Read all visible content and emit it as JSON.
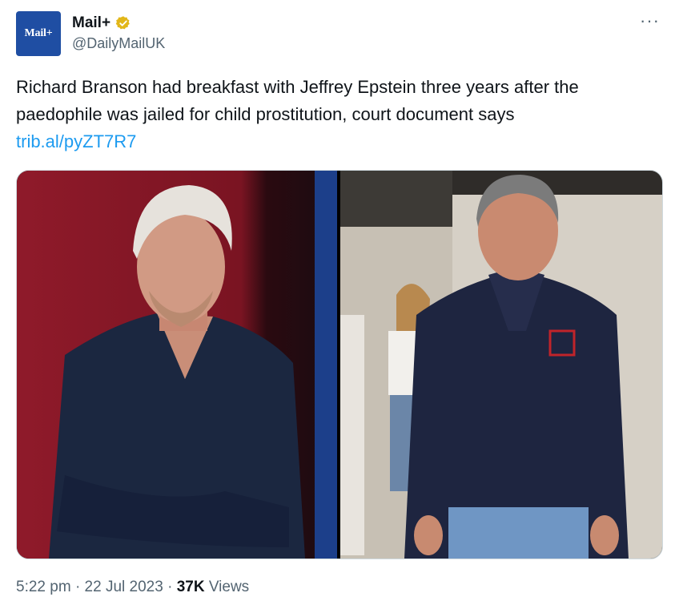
{
  "account": {
    "avatar_text": "Mail+",
    "display_name": "Mail+",
    "handle": "@DailyMailUK",
    "verified_badge": "verified-gold-icon"
  },
  "menu": {
    "more_label": "···"
  },
  "tweet": {
    "text": "Richard Branson had breakfast with Jeffrey Epstein three years after the paedophile was jailed for child prostitution, court document says",
    "link": "trib.al/pyZT7R7"
  },
  "media": {
    "left_photo": "photo of Richard Branson",
    "right_photo": "photo of Jeffrey Epstein"
  },
  "footer": {
    "time": "5:22 pm",
    "sep1": "·",
    "date": "22 Jul 2023",
    "sep2": "·",
    "views_count": "37K",
    "views_label": "Views"
  },
  "colors": {
    "link": "#1d9bf0",
    "secondary_text": "#536471",
    "avatar_bg": "#1f4ea3",
    "verified_gold": "#e2b719"
  }
}
